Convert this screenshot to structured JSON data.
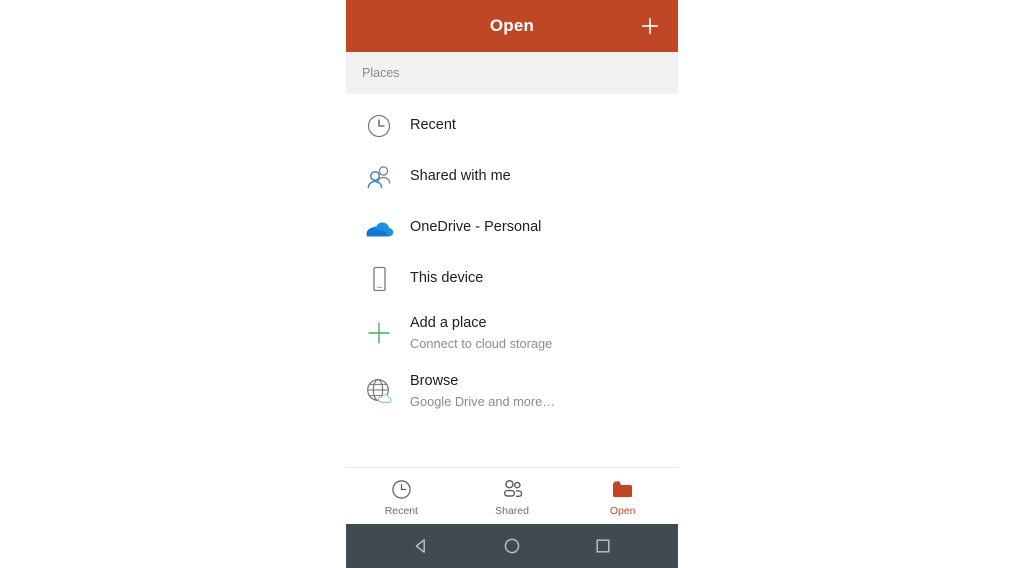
{
  "app": {
    "title": "Open",
    "add_icon": "plus-icon",
    "accent_color": "#bf4726"
  },
  "section": {
    "label": "Places",
    "background_color": "#f1f1f1"
  },
  "places": [
    {
      "title": "Recent",
      "subtitle": "",
      "icon": "clock-icon"
    },
    {
      "title": "Shared with me",
      "subtitle": "",
      "icon": "people-icon"
    },
    {
      "title": "OneDrive - Personal",
      "subtitle": "",
      "icon": "onedrive-cloud-icon"
    },
    {
      "title": "This device",
      "subtitle": "",
      "icon": "phone-icon"
    },
    {
      "title": "Add a place",
      "subtitle": "Connect to cloud storage",
      "icon": "plus-icon"
    },
    {
      "title": "Browse",
      "subtitle": "Google Drive and more…",
      "icon": "globe-cloud-icon"
    }
  ],
  "tabs": [
    {
      "label": "Recent",
      "icon": "clock-icon",
      "active": false
    },
    {
      "label": "Shared",
      "icon": "people-icon",
      "active": false
    },
    {
      "label": "Open",
      "icon": "folder-icon",
      "active": true
    }
  ],
  "navbar": {
    "background_color": "#404a51",
    "back": "back-triangle-icon",
    "home": "home-circle-icon",
    "recents": "recents-square-icon"
  }
}
